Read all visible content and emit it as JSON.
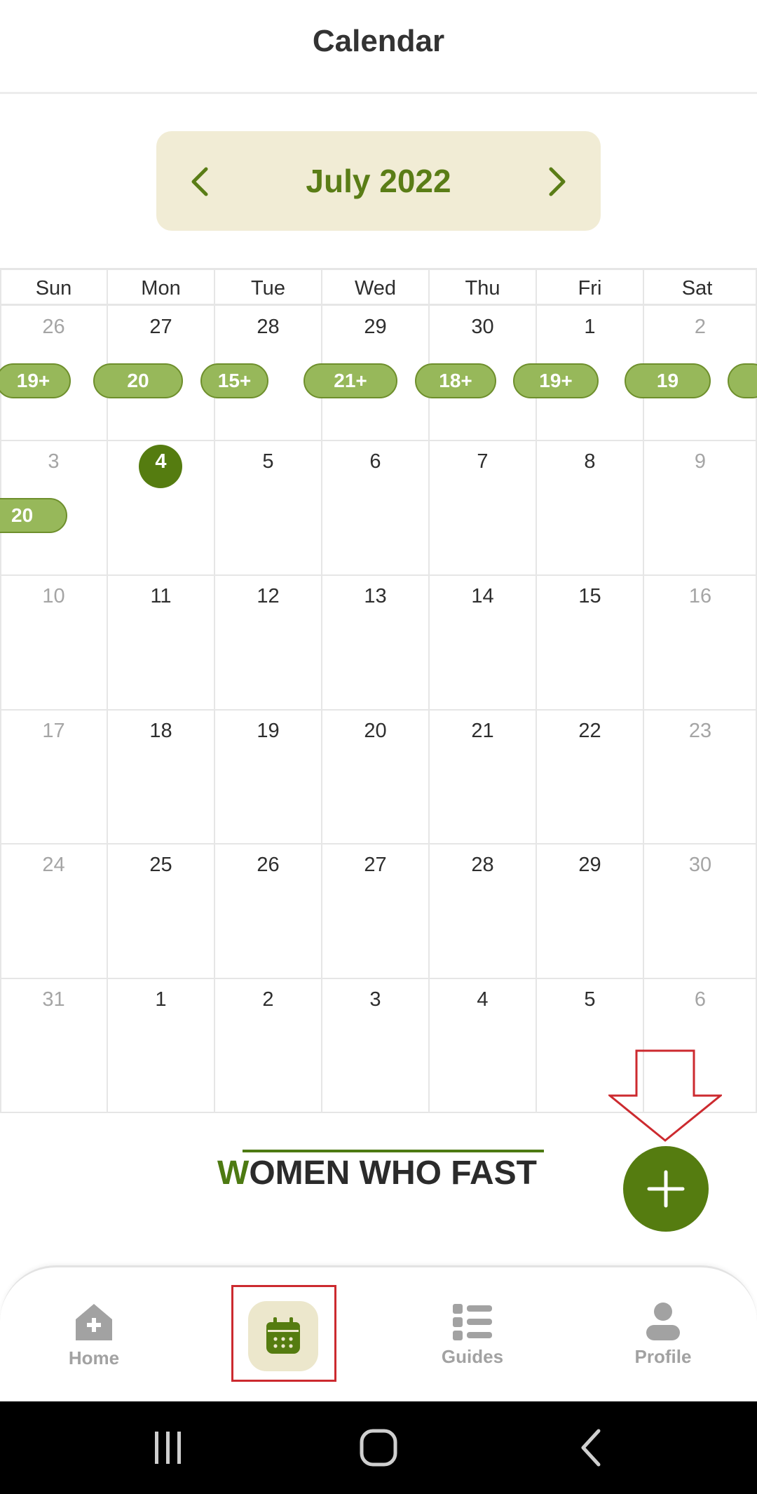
{
  "header": {
    "title": "Calendar"
  },
  "month_selector": {
    "label": "July 2022",
    "prev_icon": "chevron-left-icon",
    "next_icon": "chevron-right-icon"
  },
  "calendar": {
    "weekdays": [
      "Sun",
      "Mon",
      "Tue",
      "Wed",
      "Thu",
      "Fri",
      "Sat"
    ],
    "weeks": [
      [
        "26",
        "27",
        "28",
        "29",
        "30",
        "1",
        "2"
      ],
      [
        "3",
        "4",
        "5",
        "6",
        "7",
        "8",
        "9"
      ],
      [
        "10",
        "11",
        "12",
        "13",
        "14",
        "15",
        "16"
      ],
      [
        "17",
        "18",
        "19",
        "20",
        "21",
        "22",
        "23"
      ],
      [
        "24",
        "25",
        "26",
        "27",
        "28",
        "29",
        "30"
      ],
      [
        "31",
        "1",
        "2",
        "3",
        "4",
        "5",
        "6"
      ]
    ],
    "today": "4",
    "fasting_badges": {
      "week1": [
        "19+",
        "20",
        "15+",
        "21+",
        "18+",
        "19+",
        "19"
      ],
      "week2": [
        "20"
      ]
    }
  },
  "logo": {
    "first_letter": "W",
    "rest": "OMEN WHO FAST"
  },
  "fab": {
    "icon": "plus-icon"
  },
  "bottom_nav": {
    "home": "Home",
    "calendar_icon": "calendar-icon",
    "guides": "Guides",
    "profile": "Profile"
  },
  "colors": {
    "accent": "#557c10",
    "badge": "#97b85a",
    "month_bg": "#f1ecd5",
    "annotation": "#cc2a2f"
  }
}
